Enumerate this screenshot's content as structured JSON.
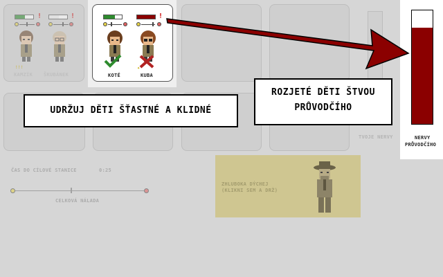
{
  "children": [
    {
      "name": "KAMZÍK",
      "calm": 0.55,
      "happy_marker": "!"
    },
    {
      "name": "ŠKUBÁNEK",
      "calm": 0.55,
      "happy_marker": "!"
    },
    {
      "name": "KOTĚ",
      "calm": 0.6,
      "status": "check"
    },
    {
      "name": "KUBA",
      "calm": 1.0,
      "status": "cross"
    }
  ],
  "tooltip_marker": "!!!",
  "callouts": {
    "keep_calm": "UDRŽUJ DĚTI ŠŤASTNÉ A KLIDNÉ",
    "annoy_line1": "ROZJETÉ DĚTI ŠTVOU",
    "annoy_line2": "PRŮVODČÍHO"
  },
  "nerves": {
    "your_label": "TVOJE NERVY",
    "leader_label_1": "NERVY",
    "leader_label_2": "PRŮVODČÍHO",
    "level": 0.85
  },
  "status": {
    "time_label": "ČAS DO CÍLOVÉ STANICE",
    "time_value": "0:25",
    "mood_label": "CELKOVÁ NÁLADA",
    "mood_level": 0.45
  },
  "breath": {
    "line1": "ZHLUBOKA DÝCHEJ",
    "line2": "(KLIKNI SEM A DRŽ)"
  },
  "colors": {
    "calm_fill": "#2e8b2e",
    "stress_fill": "#8b0000",
    "arrow": "#8b0000",
    "breath_panel": "#cfc691"
  }
}
